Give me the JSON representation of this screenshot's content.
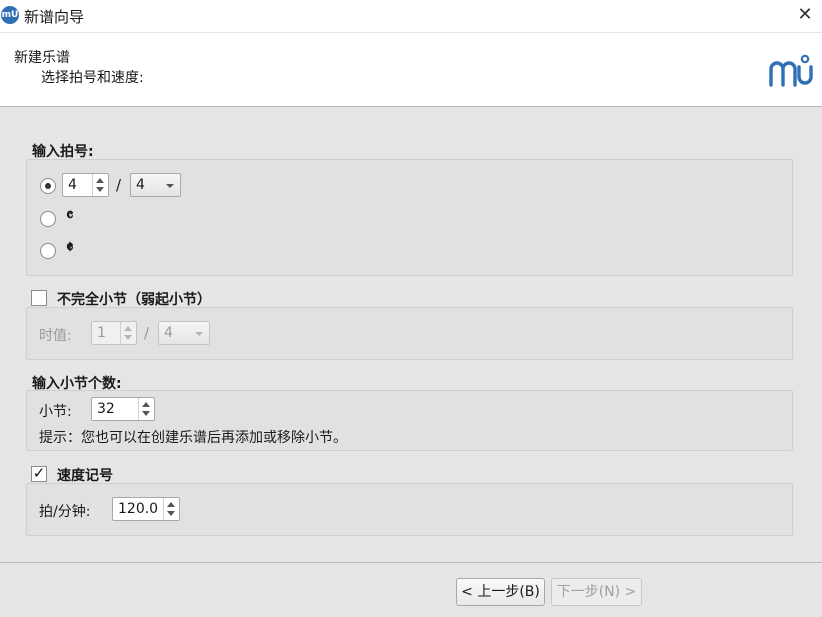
{
  "window": {
    "title": "新谱向导",
    "app_icon_text": "mU"
  },
  "header": {
    "title": "新建乐谱",
    "subtitle": "选择拍号和速度:"
  },
  "time_signature": {
    "group_title": "输入拍号:",
    "numerator": "4",
    "separator": "/",
    "denominator": "4",
    "common_time_symbol": "𝄴",
    "cut_time_symbol": "𝄵",
    "selected_option": "numeric"
  },
  "pickup": {
    "label": "不完全小节（弱起小节）",
    "checked": false,
    "duration_label": "时值:",
    "numerator": "1",
    "separator": "/",
    "denominator": "4"
  },
  "measures": {
    "group_title": "输入小节个数:",
    "label": "小节:",
    "value": "32",
    "hint": "提示：您也可以在创建乐谱后再添加或移除小节。"
  },
  "tempo": {
    "label": "速度记号",
    "checked": true,
    "bpm_label": "拍/分钟:",
    "bpm_value": "120.0"
  },
  "footer": {
    "back_label": "< 上一步(B)",
    "next_label": "下一步(N) >"
  },
  "colors": {
    "logo": "#2e6fb5"
  }
}
